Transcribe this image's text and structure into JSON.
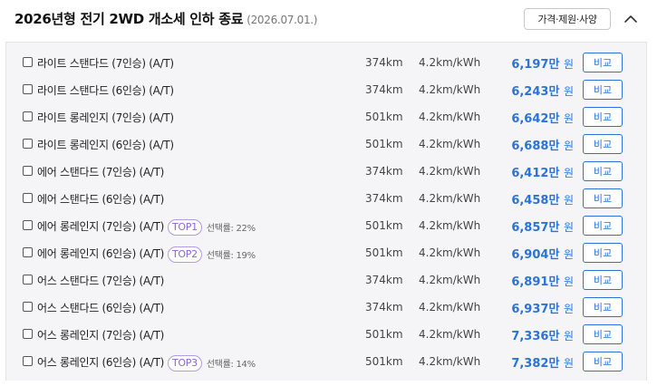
{
  "header": {
    "title": "2026년형 전기 2WD 개소세 인하 종료",
    "date": "(2026.07.01.)",
    "spec_button": "가격·제원·사양",
    "collapse_icon": "chevron-up-icon"
  },
  "trims": [
    {
      "name": "라이트 스탠다드 (7인승) (A/T)",
      "badge": "",
      "share": "",
      "range": "374km",
      "efficiency": "4.2km/kWh",
      "price": "6,197만",
      "unit": "원",
      "compare": "비교"
    },
    {
      "name": "라이트 스탠다드 (6인승) (A/T)",
      "badge": "",
      "share": "",
      "range": "374km",
      "efficiency": "4.2km/kWh",
      "price": "6,243만",
      "unit": "원",
      "compare": "비교"
    },
    {
      "name": "라이트 롱레인지 (7인승) (A/T)",
      "badge": "",
      "share": "",
      "range": "501km",
      "efficiency": "4.2km/kWh",
      "price": "6,642만",
      "unit": "원",
      "compare": "비교"
    },
    {
      "name": "라이트 롱레인지 (6인승) (A/T)",
      "badge": "",
      "share": "",
      "range": "501km",
      "efficiency": "4.2km/kWh",
      "price": "6,688만",
      "unit": "원",
      "compare": "비교"
    },
    {
      "name": "에어 스탠다드 (7인승) (A/T)",
      "badge": "",
      "share": "",
      "range": "374km",
      "efficiency": "4.2km/kWh",
      "price": "6,412만",
      "unit": "원",
      "compare": "비교"
    },
    {
      "name": "에어 스탠다드 (6인승) (A/T)",
      "badge": "",
      "share": "",
      "range": "374km",
      "efficiency": "4.2km/kWh",
      "price": "6,458만",
      "unit": "원",
      "compare": "비교"
    },
    {
      "name": "에어 롱레인지 (7인승) (A/T)",
      "badge": "TOP1",
      "share": "선택률: 22%",
      "range": "501km",
      "efficiency": "4.2km/kWh",
      "price": "6,857만",
      "unit": "원",
      "compare": "비교"
    },
    {
      "name": "에어 롱레인지 (6인승) (A/T)",
      "badge": "TOP2",
      "share": "선택률: 19%",
      "range": "501km",
      "efficiency": "4.2km/kWh",
      "price": "6,904만",
      "unit": "원",
      "compare": "비교"
    },
    {
      "name": "어스 스탠다드 (7인승) (A/T)",
      "badge": "",
      "share": "",
      "range": "374km",
      "efficiency": "4.2km/kWh",
      "price": "6,891만",
      "unit": "원",
      "compare": "비교"
    },
    {
      "name": "어스 스탠다드 (6인승) (A/T)",
      "badge": "",
      "share": "",
      "range": "374km",
      "efficiency": "4.2km/kWh",
      "price": "6,937만",
      "unit": "원",
      "compare": "비교"
    },
    {
      "name": "어스 롱레인지 (7인승) (A/T)",
      "badge": "",
      "share": "",
      "range": "501km",
      "efficiency": "4.2km/kWh",
      "price": "7,336만",
      "unit": "원",
      "compare": "비교"
    },
    {
      "name": "어스 롱레인지 (6인승) (A/T)",
      "badge": "TOP3",
      "share": "선택률: 14%",
      "range": "501km",
      "efficiency": "4.2km/kWh",
      "price": "7,382만",
      "unit": "원",
      "compare": "비교"
    }
  ],
  "colors": {
    "accent": "#2b73d9",
    "badge": "#8b64d9",
    "panel_bg": "#f5f5f7"
  }
}
